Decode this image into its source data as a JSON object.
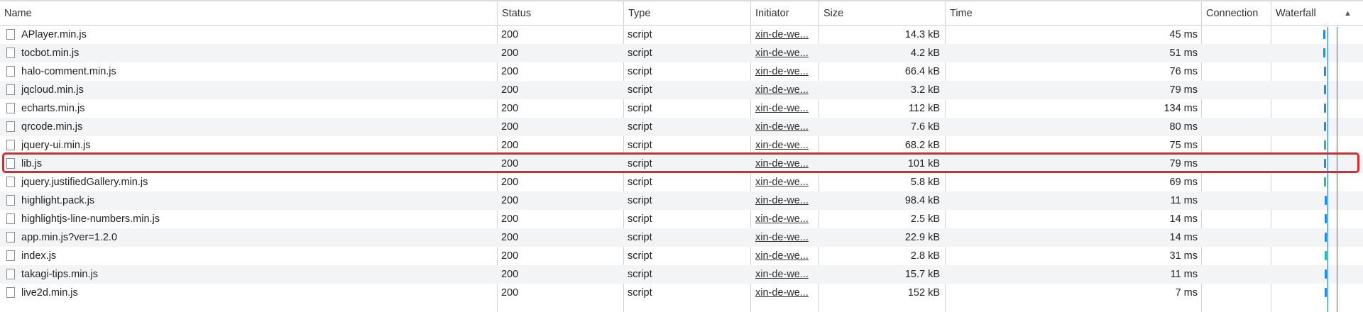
{
  "columns": {
    "name": "Name",
    "status": "Status",
    "type": "Type",
    "initiator": "Initiator",
    "size": "Size",
    "time": "Time",
    "connection": "Connection",
    "waterfall": "Waterfall"
  },
  "sort_indicator": "▲",
  "rows": [
    {
      "name": "APlayer.min.js",
      "status": "200",
      "type": "script",
      "initiator": "xin-de-we...",
      "size": "14.3 kB",
      "time": "45 ms"
    },
    {
      "name": "tocbot.min.js",
      "status": "200",
      "type": "script",
      "initiator": "xin-de-we...",
      "size": "4.2 kB",
      "time": "51 ms"
    },
    {
      "name": "halo-comment.min.js",
      "status": "200",
      "type": "script",
      "initiator": "xin-de-we...",
      "size": "66.4 kB",
      "time": "76 ms"
    },
    {
      "name": "jqcloud.min.js",
      "status": "200",
      "type": "script",
      "initiator": "xin-de-we...",
      "size": "3.2 kB",
      "time": "79 ms"
    },
    {
      "name": "echarts.min.js",
      "status": "200",
      "type": "script",
      "initiator": "xin-de-we...",
      "size": "112 kB",
      "time": "134 ms"
    },
    {
      "name": "qrcode.min.js",
      "status": "200",
      "type": "script",
      "initiator": "xin-de-we...",
      "size": "7.6 kB",
      "time": "80 ms"
    },
    {
      "name": "jquery-ui.min.js",
      "status": "200",
      "type": "script",
      "initiator": "xin-de-we...",
      "size": "68.2 kB",
      "time": "75 ms"
    },
    {
      "name": "lib.js",
      "status": "200",
      "type": "script",
      "initiator": "xin-de-we...",
      "size": "101 kB",
      "time": "79 ms"
    },
    {
      "name": "jquery.justifiedGallery.min.js",
      "status": "200",
      "type": "script",
      "initiator": "xin-de-we...",
      "size": "5.8 kB",
      "time": "69 ms"
    },
    {
      "name": "highlight.pack.js",
      "status": "200",
      "type": "script",
      "initiator": "xin-de-we...",
      "size": "98.4 kB",
      "time": "11 ms"
    },
    {
      "name": "highlightjs-line-numbers.min.js",
      "status": "200",
      "type": "script",
      "initiator": "xin-de-we...",
      "size": "2.5 kB",
      "time": "14 ms"
    },
    {
      "name": "app.min.js?ver=1.2.0",
      "status": "200",
      "type": "script",
      "initiator": "xin-de-we...",
      "size": "22.9 kB",
      "time": "14 ms"
    },
    {
      "name": "index.js",
      "status": "200",
      "type": "script",
      "initiator": "xin-de-we...",
      "size": "2.8 kB",
      "time": "31 ms"
    },
    {
      "name": "takagi-tips.min.js",
      "status": "200",
      "type": "script",
      "initiator": "xin-de-we...",
      "size": "15.7 kB",
      "time": "11 ms"
    },
    {
      "name": "live2d.min.js",
      "status": "200",
      "type": "script",
      "initiator": "xin-de-we...",
      "size": "152 kB",
      "time": "7 ms"
    }
  ],
  "highlighted_row": "lib.js",
  "colors": {
    "bar_blue": "#1a8fe3",
    "bar_teal": "#1fbf9f",
    "dom_content_loaded_line": "#1a5fd0",
    "load_line": "#d93025",
    "highlight_border": "#e8242a"
  }
}
